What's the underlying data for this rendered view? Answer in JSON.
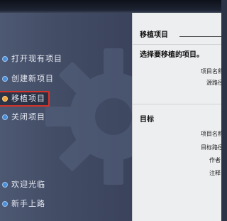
{
  "sidebar": {
    "items": [
      {
        "label": "打开现有项目"
      },
      {
        "label": "创建新项目"
      },
      {
        "label": "移植项目"
      },
      {
        "label": "关闭项目"
      },
      {
        "label": "欢迎光临"
      },
      {
        "label": "新手上路"
      }
    ],
    "selected_index": 2
  },
  "panel": {
    "title": "移植项目",
    "source_heading": "选择要移植的项目。",
    "source_fields": [
      "项目名称",
      "源路径"
    ],
    "target_heading": "目标",
    "target_fields": [
      "项目名称",
      "目标路径",
      "作者",
      "注释"
    ]
  },
  "colors": {
    "sidebar": "#434d66",
    "selection_border": "#d4332a",
    "bullet": "#4a8fd6",
    "bullet_active": "#f0a53a",
    "panel": "#edeef0"
  }
}
